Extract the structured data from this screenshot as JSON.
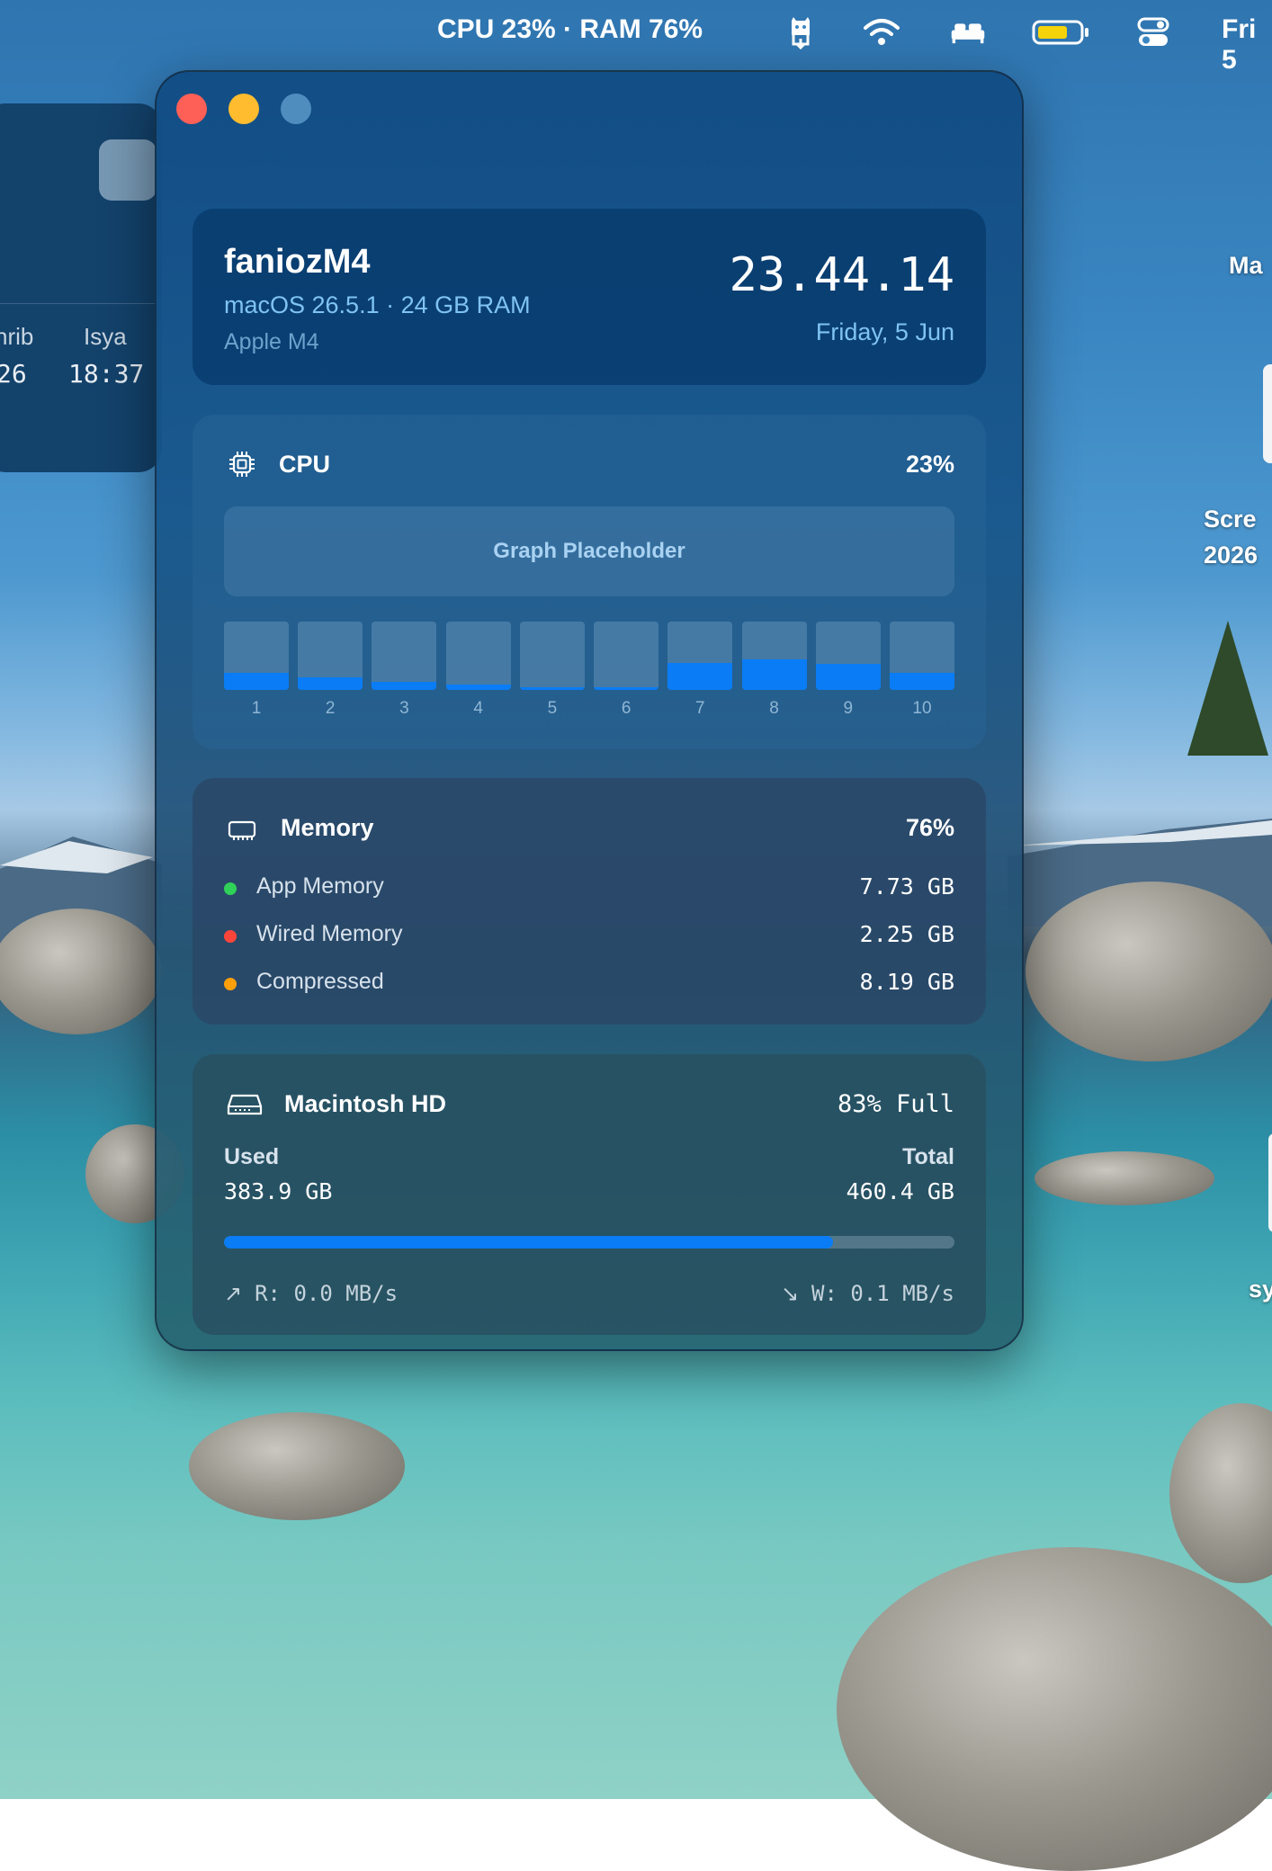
{
  "menubar": {
    "stats": "CPU 23% · RAM 76%",
    "clock": "Fri 5",
    "icons": [
      "app-status-icon",
      "wifi-icon",
      "bed-icon",
      "battery-icon",
      "control-center-icon"
    ]
  },
  "background_widget": {
    "col1_name": "hrib",
    "col1_time": "26",
    "col2_name": "Isya",
    "col2_time": "18:37"
  },
  "desktop": {
    "label_top": "Ma",
    "label_screenshot_1": "Scre",
    "label_screenshot_2": "2026",
    "label_bottom": "sy"
  },
  "window": {
    "header": {
      "hostname": "faniozM4",
      "os_info": "macOS 26.5.1 · 24 GB RAM",
      "chip": "Apple M4",
      "time": "23.44.14",
      "date": "Friday, 5 Jun"
    },
    "cpu": {
      "title": "CPU",
      "value": "23%",
      "graph_placeholder": "Graph Placeholder",
      "cores": [
        {
          "label": "1",
          "load": 0.25
        },
        {
          "label": "2",
          "load": 0.18
        },
        {
          "label": "3",
          "load": 0.12
        },
        {
          "label": "4",
          "load": 0.08
        },
        {
          "label": "5",
          "load": 0.04
        },
        {
          "label": "6",
          "load": 0.04
        },
        {
          "label": "7",
          "load": 0.4
        },
        {
          "label": "8",
          "load": 0.45
        },
        {
          "label": "9",
          "load": 0.38
        },
        {
          "label": "10",
          "load": 0.25
        }
      ]
    },
    "memory": {
      "title": "Memory",
      "value": "76%",
      "rows": [
        {
          "label": "App Memory",
          "value": "7.73 GB",
          "color": "#30d158"
        },
        {
          "label": "Wired Memory",
          "value": "2.25 GB",
          "color": "#ff453a"
        },
        {
          "label": "Compressed",
          "value": "8.19 GB",
          "color": "#ff9f0a"
        }
      ]
    },
    "disk": {
      "title": "Macintosh HD",
      "value": "83% Full",
      "used_label": "Used",
      "used_value": "383.9 GB",
      "total_label": "Total",
      "total_value": "460.4 GB",
      "fill_fraction": 0.834,
      "read": "R: 0.0 MB/s",
      "write": "W: 0.1 MB/s"
    }
  },
  "colors": {
    "accent": "#0a7cf5",
    "close": "#fe5f57",
    "minimize": "#febc2e",
    "zoom": "#4f8dbf"
  }
}
